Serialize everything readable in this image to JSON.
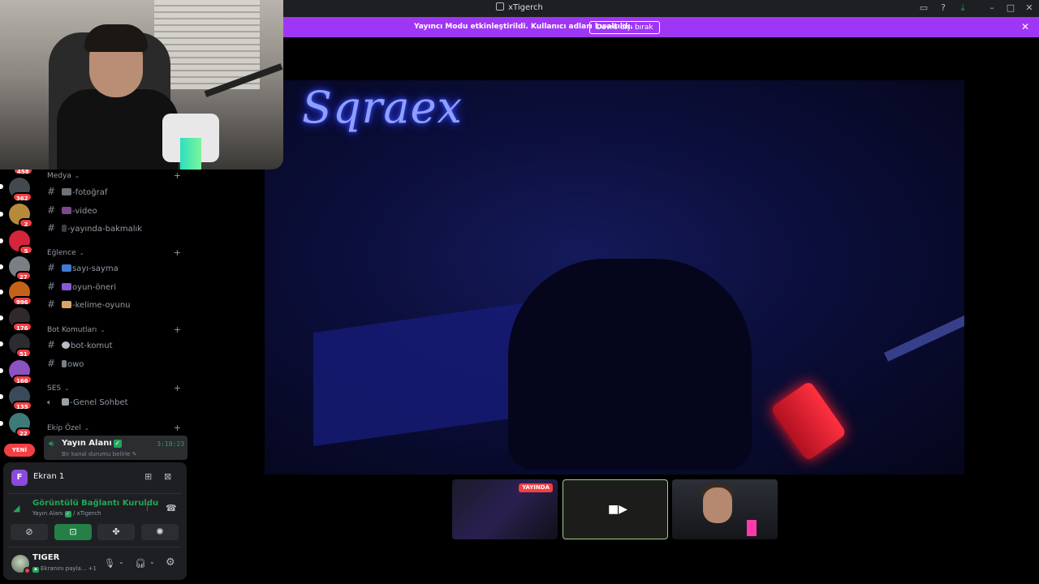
{
  "window": {
    "title": "xTigerch"
  },
  "banner": {
    "message": "Yayıncı Modu etkinleştirildi. Kullanıcı adları kısaltıldı.",
    "button": "Devre dışı bırak"
  },
  "servers": [
    {
      "badge": "362",
      "color": "#44494f"
    },
    {
      "badge": "2",
      "color": "#b58a3a"
    },
    {
      "badge": "5",
      "color": "#d6243a"
    },
    {
      "badge": "27",
      "color": "#7a7f86"
    },
    {
      "badge": "996",
      "color": "#c4621a"
    },
    {
      "badge": "176",
      "color": "#30282a"
    },
    {
      "badge": "51",
      "color": "#2a2c30"
    },
    {
      "badge": "166",
      "color": "#8c53c0"
    },
    {
      "badge": "135",
      "color": "#3a4a5c"
    },
    {
      "badge": "22",
      "color": "#3e7a78"
    }
  ],
  "top_badge": "458",
  "new_label": "YENİ",
  "channels": {
    "cat_media": "Medya",
    "ch_photo": "-fotoğraf",
    "ch_video": "-video",
    "ch_watch": "-yayında-bakmalık",
    "cat_fun": "Eğlence",
    "ch_count": "sayı-sayma",
    "ch_game": "oyun-öneri",
    "ch_word": "-kelime-oyunu",
    "cat_bot": "Bot Komutları",
    "ch_botcmd": "bot-komut",
    "ch_owo": "owo",
    "cat_voice": "SES",
    "ch_general": "-Genel Sohbet",
    "cat_team": "Ekip Özel",
    "active_name": "Yayın Alanı",
    "active_sub": "Bir kanal durumu belirle",
    "active_time": "3:18:23"
  },
  "panel": {
    "screen_initial": "F",
    "screen_label": "Ekran 1",
    "conn_title": "Görüntülü Bağlantı Kuruldu",
    "conn_channel": "Yayın Alanı",
    "conn_server": "/ xTigerch",
    "user_name": "TIGER",
    "user_status": "Ekranını payla...",
    "user_extra": "+1"
  },
  "stream": {
    "neon_text": "Sqraex"
  },
  "thumbs": {
    "live_label": "YAYINDA"
  }
}
